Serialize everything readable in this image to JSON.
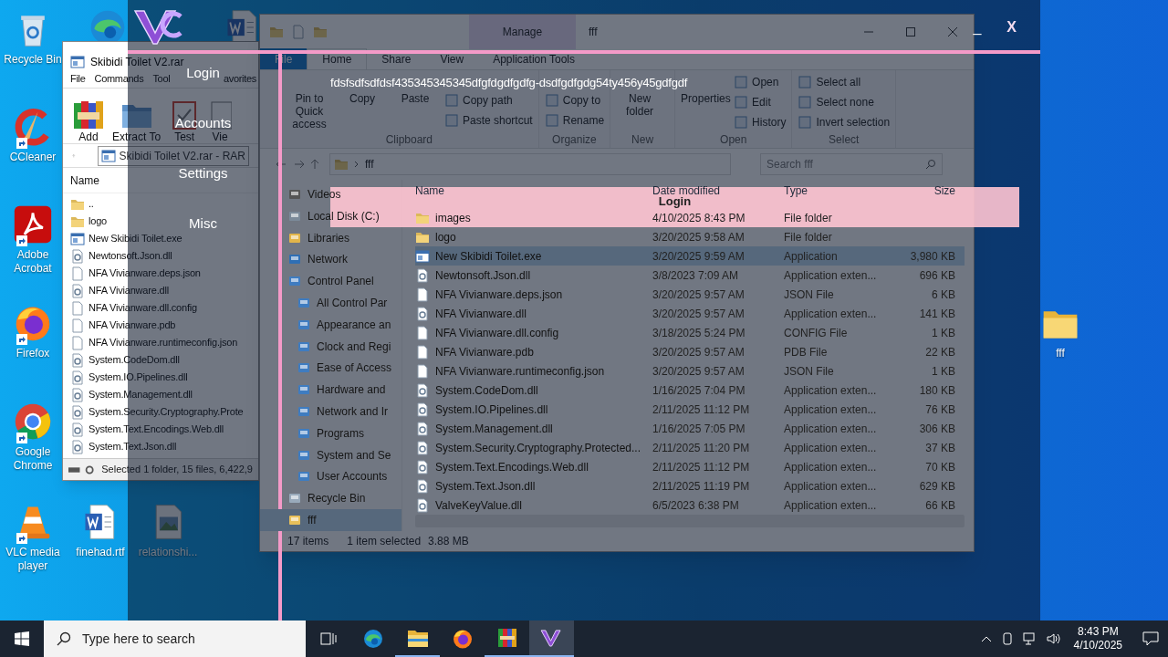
{
  "desktop_icons": [
    {
      "kind": "recycle",
      "label": "Recycle Bin",
      "shortcut": false
    },
    {
      "kind": "edge",
      "shortcut": false
    },
    {
      "kind": "word",
      "shortcut": false
    },
    {
      "kind": "ccleaner",
      "label": "CCleaner",
      "shortcut": true
    },
    {
      "kind": "acrobat",
      "label": "Adobe Acrobat",
      "shortcut": true
    },
    {
      "kind": "firefox",
      "label": "Firefox",
      "shortcut": true
    },
    {
      "kind": "chrome",
      "label": "Google Chrome",
      "shortcut": true
    },
    {
      "kind": "vlc",
      "label": "VLC media player",
      "shortcut": true
    },
    {
      "kind": "word",
      "label": "finehad.rtf",
      "shortcut": false
    },
    {
      "kind": "image",
      "label": "relationshi...",
      "shortcut": false
    },
    {
      "kind": "folder",
      "label": "fff",
      "shortcut": false
    }
  ],
  "winrar": {
    "title": "Skibidi Toilet V2.rar",
    "menu": [
      "File",
      "Commands",
      "Tool",
      "avorites"
    ],
    "toolbar": [
      {
        "label": "Add",
        "kind": "add"
      },
      {
        "label": "Extract To",
        "kind": "extract"
      },
      {
        "label": "Test",
        "kind": "test"
      },
      {
        "label": "Vie",
        "kind": "view"
      }
    ],
    "path": "Skibidi Toilet V2.rar - RAR",
    "column": "Name",
    "files": [
      {
        "name": "..",
        "kind": "folder"
      },
      {
        "name": "logo",
        "kind": "folder"
      },
      {
        "name": "New Skibidi Toilet.exe",
        "kind": "exe"
      },
      {
        "name": "Newtonsoft.Json.dll",
        "kind": "dll"
      },
      {
        "name": "NFA Vivianware.deps.json",
        "kind": "file"
      },
      {
        "name": "NFA Vivianware.dll",
        "kind": "dll"
      },
      {
        "name": "NFA Vivianware.dll.config",
        "kind": "file"
      },
      {
        "name": "NFA Vivianware.pdb",
        "kind": "file"
      },
      {
        "name": "NFA Vivianware.runtimeconfig.json",
        "kind": "file"
      },
      {
        "name": "System.CodeDom.dll",
        "kind": "dll"
      },
      {
        "name": "System.IO.Pipelines.dll",
        "kind": "dll"
      },
      {
        "name": "System.Management.dll",
        "kind": "dll"
      },
      {
        "name": "System.Security.Cryptography.Prote",
        "kind": "dll"
      },
      {
        "name": "System.Text.Encodings.Web.dll",
        "kind": "dll"
      },
      {
        "name": "System.Text.Json.dll",
        "kind": "dll"
      }
    ],
    "status": "Selected 1 folder, 15 files, 6,422,9"
  },
  "explorer": {
    "title": "fff",
    "context_tab": "Manage",
    "tabs": [
      {
        "label": "File",
        "kind": "file",
        "selected": false
      },
      {
        "label": "Home",
        "kind": "tab",
        "selected": true
      },
      {
        "label": "Share",
        "kind": "tab",
        "selected": false
      },
      {
        "label": "View",
        "kind": "tab",
        "selected": false
      },
      {
        "label": "Application Tools",
        "kind": "tab",
        "selected": false
      }
    ],
    "ribbon": [
      {
        "label": "Clipboard",
        "items": [
          {
            "label": "Pin to Quick access",
            "kind": "large"
          },
          {
            "label": "Copy",
            "kind": "large"
          },
          {
            "label": "Paste",
            "kind": "large"
          },
          {
            "label": "Copy path",
            "kind": "small"
          },
          {
            "label": "Paste shortcut",
            "kind": "small"
          }
        ]
      },
      {
        "label": "Organize",
        "items": [
          {
            "label": "Copy to",
            "kind": "small"
          },
          {
            "label": "Rename",
            "kind": "small"
          }
        ]
      },
      {
        "label": "New",
        "items": [
          {
            "label": "New folder",
            "kind": "large"
          }
        ]
      },
      {
        "label": "Open",
        "items": [
          {
            "label": "Properties",
            "kind": "large"
          },
          {
            "label": "Open",
            "kind": "small"
          },
          {
            "label": "Edit",
            "kind": "small"
          },
          {
            "label": "History",
            "kind": "small"
          }
        ]
      },
      {
        "label": "Select",
        "items": [
          {
            "label": "Select all",
            "kind": "small"
          },
          {
            "label": "Select none",
            "kind": "small"
          },
          {
            "label": "Invert selection",
            "kind": "small"
          }
        ]
      }
    ],
    "path": "fff",
    "search": {
      "placeholder": "Search fff"
    },
    "nav": [
      {
        "label": "Videos",
        "kind": "videos",
        "selected": false
      },
      {
        "label": "Local Disk (C:)",
        "kind": "drive",
        "selected": false
      },
      {
        "label": "Libraries",
        "kind": "library",
        "selected": false
      },
      {
        "label": "Network",
        "kind": "network",
        "selected": false
      },
      {
        "label": "Control Panel",
        "kind": "panel",
        "selected": false,
        "children": [
          {
            "label": "All Control Par",
            "kind": "panel",
            "selected": false
          },
          {
            "label": "Appearance an",
            "kind": "panel",
            "selected": false
          },
          {
            "label": "Clock and Regi",
            "kind": "panel",
            "selected": false
          },
          {
            "label": "Ease of Access",
            "kind": "panel",
            "selected": false
          },
          {
            "label": "Hardware and",
            "kind": "panel",
            "selected": false
          },
          {
            "label": "Network and Ir",
            "kind": "panel",
            "selected": false
          },
          {
            "label": "Programs",
            "kind": "panel",
            "selected": false
          },
          {
            "label": "System and Se",
            "kind": "panel",
            "selected": false
          },
          {
            "label": "User Accounts",
            "kind": "panel",
            "selected": false
          }
        ]
      },
      {
        "label": "Recycle Bin",
        "kind": "recycle",
        "selected": false
      },
      {
        "label": "fff",
        "kind": "folder",
        "selected": true
      }
    ],
    "columns": [
      "Name",
      "Date modified",
      "Type",
      "Size"
    ],
    "rows": [
      {
        "name": "images",
        "date": "4/10/2025 8:43 PM",
        "type": "File folder",
        "kind": "folder",
        "selected": false
      },
      {
        "name": "logo",
        "date": "3/20/2025 9:58 AM",
        "type": "File folder",
        "kind": "folder",
        "selected": false
      },
      {
        "name": "New Skibidi Toilet.exe",
        "date": "3/20/2025 9:59 AM",
        "type": "Application",
        "size": "3,980 KB",
        "kind": "exe",
        "selected": true
      },
      {
        "name": "Newtonsoft.Json.dll",
        "date": "3/8/2023 7:09 AM",
        "type": "Application exten...",
        "size": "696 KB",
        "kind": "dll",
        "selected": false
      },
      {
        "name": "NFA Vivianware.deps.json",
        "date": "3/20/2025 9:57 AM",
        "type": "JSON File",
        "size": "6 KB",
        "kind": "file",
        "selected": false
      },
      {
        "name": "NFA Vivianware.dll",
        "date": "3/20/2025 9:57 AM",
        "type": "Application exten...",
        "size": "141 KB",
        "kind": "dll",
        "selected": false
      },
      {
        "name": "NFA Vivianware.dll.config",
        "date": "3/18/2025 5:24 PM",
        "type": "CONFIG File",
        "size": "1 KB",
        "kind": "file",
        "selected": false
      },
      {
        "name": "NFA Vivianware.pdb",
        "date": "3/20/2025 9:57 AM",
        "type": "PDB File",
        "size": "22 KB",
        "kind": "file",
        "selected": false
      },
      {
        "name": "NFA Vivianware.runtimeconfig.json",
        "date": "3/20/2025 9:57 AM",
        "type": "JSON File",
        "size": "1 KB",
        "kind": "file",
        "selected": false
      },
      {
        "name": "System.CodeDom.dll",
        "date": "1/16/2025 7:04 PM",
        "type": "Application exten...",
        "size": "180 KB",
        "kind": "dll",
        "selected": false
      },
      {
        "name": "System.IO.Pipelines.dll",
        "date": "2/11/2025 11:12 PM",
        "type": "Application exten...",
        "size": "76 KB",
        "kind": "dll",
        "selected": false
      },
      {
        "name": "System.Management.dll",
        "date": "1/16/2025 7:05 PM",
        "type": "Application exten...",
        "size": "306 KB",
        "kind": "dll",
        "selected": false
      },
      {
        "name": "System.Security.Cryptography.Protected...",
        "date": "2/11/2025 11:20 PM",
        "type": "Application exten...",
        "size": "37 KB",
        "kind": "dll",
        "selected": false
      },
      {
        "name": "System.Text.Encodings.Web.dll",
        "date": "2/11/2025 11:12 PM",
        "type": "Application exten...",
        "size": "70 KB",
        "kind": "dll",
        "selected": false
      },
      {
        "name": "System.Text.Json.dll",
        "date": "2/11/2025 11:19 PM",
        "type": "Application exten...",
        "size": "629 KB",
        "kind": "dll",
        "selected": false
      },
      {
        "name": "ValveKeyValue.dll",
        "date": "6/5/2023 6:38 PM",
        "type": "Application exten...",
        "size": "66 KB",
        "kind": "dll",
        "selected": false
      }
    ],
    "status": {
      "count": "17 items",
      "selection": "1 item selected",
      "size": "3.88 MB"
    }
  },
  "overlay": {
    "title": "fdsfsdfsdfdsf435345345345dfgfdgdfgdfg-dsdfgdfgdg54ty456y45gdfgdf",
    "menu": [
      "Login",
      "Accounts",
      "Settings",
      "Misc"
    ],
    "banner": "Login",
    "minimize": "_",
    "close": "X"
  },
  "taskbar": {
    "search": {
      "placeholder": "Type here to search"
    },
    "apps": [
      {
        "kind": "taskview",
        "running": false,
        "selected": false
      },
      {
        "kind": "edge",
        "running": false,
        "selected": false
      },
      {
        "kind": "explorer",
        "running": true,
        "selected": false
      },
      {
        "kind": "firefox",
        "running": false,
        "selected": false
      },
      {
        "kind": "winrar",
        "running": true,
        "selected": false
      },
      {
        "kind": "vc",
        "running": true,
        "selected": true
      }
    ],
    "time": "8:43 PM",
    "date": "4/10/2025"
  }
}
